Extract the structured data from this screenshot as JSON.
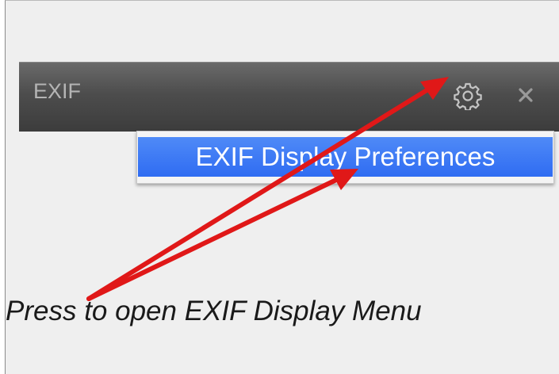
{
  "panel": {
    "title": "EXIF",
    "settings_icon": "gear-icon",
    "close_icon": "close-icon"
  },
  "menu": {
    "items": [
      {
        "label": "EXIF Display Preferences",
        "highlighted": true
      }
    ]
  },
  "annotation": {
    "caption": "Press to open EXIF Display Menu",
    "arrow_color": "#e01818"
  },
  "colors": {
    "header_bg": "#4d4d4d",
    "highlight": "#3572f4",
    "canvas_bg": "#efefef"
  }
}
